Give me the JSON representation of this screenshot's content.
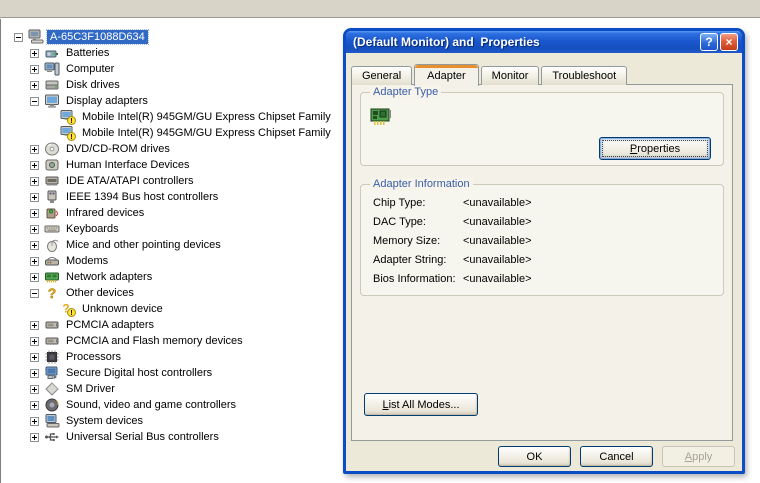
{
  "tree": {
    "items": [
      {
        "label": "A-65C3F1088D634",
        "level": 0,
        "expand": "minus",
        "icon": "computer-root",
        "selected": true
      },
      {
        "label": "Batteries",
        "level": 1,
        "expand": "plus",
        "icon": "battery",
        "selected": false
      },
      {
        "label": "Computer",
        "level": 1,
        "expand": "plus",
        "icon": "computer",
        "selected": false
      },
      {
        "label": "Disk drives",
        "level": 1,
        "expand": "plus",
        "icon": "disk",
        "selected": false
      },
      {
        "label": "Display adapters",
        "level": 1,
        "expand": "minus",
        "icon": "display",
        "selected": false
      },
      {
        "label": "Mobile Intel(R) 945GM/GU Express Chipset Family",
        "level": 2,
        "expand": null,
        "icon": "display-warning",
        "selected": false
      },
      {
        "label": "Mobile Intel(R) 945GM/GU Express Chipset Family",
        "level": 2,
        "expand": null,
        "icon": "display-warning",
        "selected": false
      },
      {
        "label": "DVD/CD-ROM drives",
        "level": 1,
        "expand": "plus",
        "icon": "cdrom",
        "selected": false
      },
      {
        "label": "Human Interface Devices",
        "level": 1,
        "expand": "plus",
        "icon": "hid",
        "selected": false
      },
      {
        "label": "IDE ATA/ATAPI controllers",
        "level": 1,
        "expand": "plus",
        "icon": "ide",
        "selected": false
      },
      {
        "label": "IEEE 1394 Bus host controllers",
        "level": 1,
        "expand": "plus",
        "icon": "ieee1394",
        "selected": false
      },
      {
        "label": "Infrared devices",
        "level": 1,
        "expand": "plus",
        "icon": "infrared",
        "selected": false
      },
      {
        "label": "Keyboards",
        "level": 1,
        "expand": "plus",
        "icon": "keyboard",
        "selected": false
      },
      {
        "label": "Mice and other pointing devices",
        "level": 1,
        "expand": "plus",
        "icon": "mouse",
        "selected": false
      },
      {
        "label": "Modems",
        "level": 1,
        "expand": "plus",
        "icon": "modem",
        "selected": false
      },
      {
        "label": "Network adapters",
        "level": 1,
        "expand": "plus",
        "icon": "network",
        "selected": false
      },
      {
        "label": "Other devices",
        "level": 1,
        "expand": "minus",
        "icon": "question",
        "selected": false
      },
      {
        "label": "Unknown device",
        "level": 2,
        "expand": null,
        "icon": "question-warning",
        "selected": false
      },
      {
        "label": "PCMCIA adapters",
        "level": 1,
        "expand": "plus",
        "icon": "pcmcia",
        "selected": false
      },
      {
        "label": "PCMCIA and Flash memory devices",
        "level": 1,
        "expand": "plus",
        "icon": "pcmcia",
        "selected": false
      },
      {
        "label": "Processors",
        "level": 1,
        "expand": "plus",
        "icon": "processor",
        "selected": false
      },
      {
        "label": "Secure Digital host controllers",
        "level": 1,
        "expand": "plus",
        "icon": "sd",
        "selected": false
      },
      {
        "label": "SM Driver",
        "level": 1,
        "expand": "plus",
        "icon": "diamond",
        "selected": false
      },
      {
        "label": "Sound, video and game controllers",
        "level": 1,
        "expand": "plus",
        "icon": "sound",
        "selected": false
      },
      {
        "label": "System devices",
        "level": 1,
        "expand": "plus",
        "icon": "system",
        "selected": false
      },
      {
        "label": "Universal Serial Bus controllers",
        "level": 1,
        "expand": "plus",
        "icon": "usb",
        "selected": false
      }
    ]
  },
  "dialog": {
    "title": "(Default Monitor) and  Properties",
    "titlebar": {
      "help_label": "?",
      "close_label": "×"
    },
    "tabs": [
      {
        "label": "General",
        "active": false
      },
      {
        "label": "Adapter",
        "active": true
      },
      {
        "label": "Monitor",
        "active": false
      },
      {
        "label": "Troubleshoot",
        "active": false
      }
    ],
    "adapter_type": {
      "caption": "Adapter Type",
      "properties_button": "Properties"
    },
    "adapter_info": {
      "caption": "Adapter Information",
      "rows": [
        {
          "label": "Chip Type:",
          "value": "<unavailable>"
        },
        {
          "label": "DAC Type:",
          "value": "<unavailable>"
        },
        {
          "label": "Memory Size:",
          "value": "<unavailable>"
        },
        {
          "label": "Adapter String:",
          "value": "<unavailable>"
        },
        {
          "label": "Bios Information:",
          "value": "<unavailable>"
        }
      ]
    },
    "list_all_modes_button": "List All Modes...",
    "buttons": {
      "ok": "OK",
      "cancel": "Cancel",
      "apply": "Apply"
    },
    "mnemonics": {
      "properties": "P",
      "list_all_modes": "L",
      "apply": "A"
    },
    "colors": {
      "titlebar_blue": "#1A57CE",
      "dialog_border": "#0B4DC6",
      "dialog_face": "#ECE9D8",
      "selection_blue": "#316AC5",
      "groupbox_caption": "#3A5DA8",
      "active_tab_highlight": "#E78F2E",
      "close_button_red": "#E25E3C"
    }
  }
}
